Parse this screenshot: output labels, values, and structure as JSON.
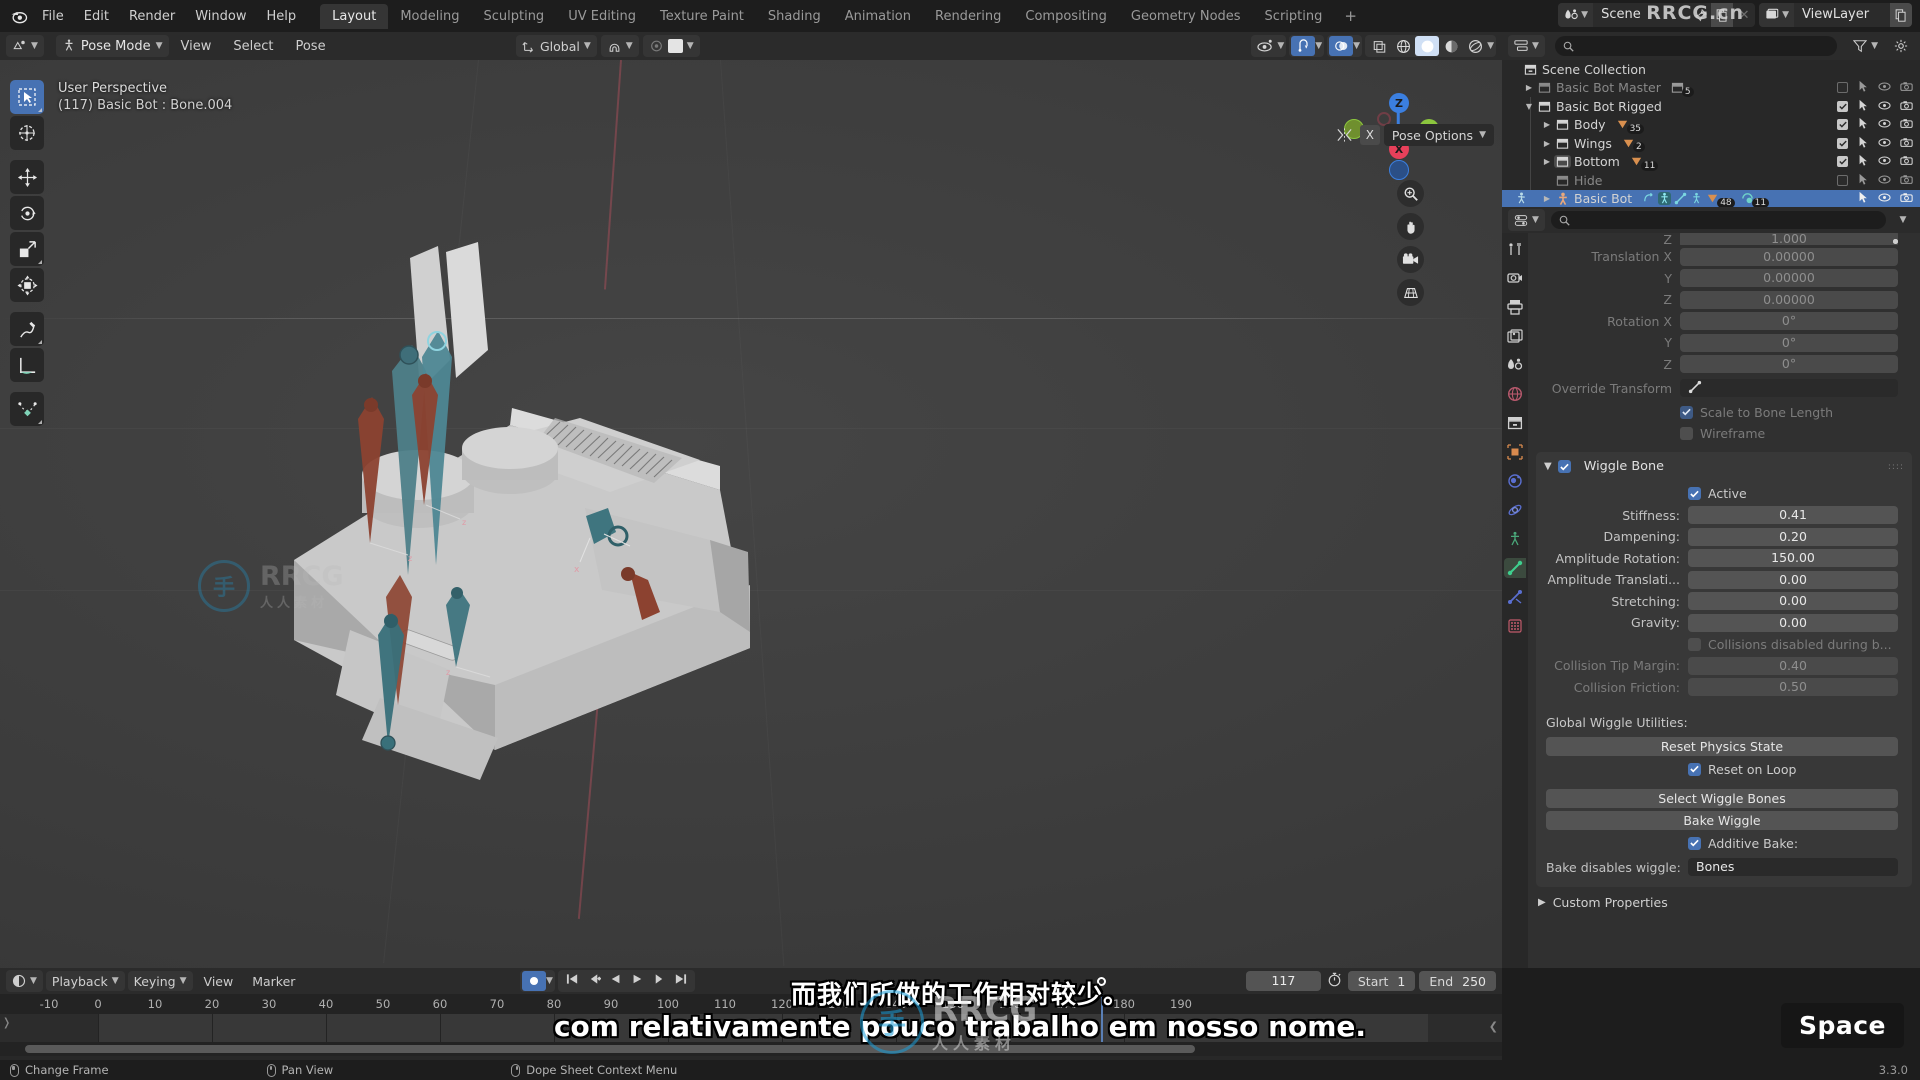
{
  "app": {
    "name": "Blender",
    "version": "3.3.0",
    "logo_icon": "blender-logo"
  },
  "topbar": {
    "menus": [
      "File",
      "Edit",
      "Render",
      "Window",
      "Help"
    ],
    "workspaces": [
      {
        "label": "Layout",
        "active": true
      },
      {
        "label": "Modeling",
        "active": false
      },
      {
        "label": "Sculpting",
        "active": false
      },
      {
        "label": "UV Editing",
        "active": false
      },
      {
        "label": "Texture Paint",
        "active": false
      },
      {
        "label": "Shading",
        "active": false
      },
      {
        "label": "Animation",
        "active": false
      },
      {
        "label": "Rendering",
        "active": false
      },
      {
        "label": "Compositing",
        "active": false
      },
      {
        "label": "Geometry Nodes",
        "active": false
      },
      {
        "label": "Scripting",
        "active": false
      }
    ],
    "add_workspace": "+",
    "scene": {
      "icon": "scene-icon",
      "name": "Scene",
      "pin_icon": "pin-icon",
      "copy_icon": "new-scene-icon",
      "close_icon": "close-icon"
    },
    "viewlayer": {
      "icon": "viewlayer-icon",
      "name": "ViewLayer",
      "copy_icon": "new-viewlayer-icon"
    }
  },
  "viewport_header": {
    "editor_type_icon": "editor-3dview-icon",
    "mode_icon": "pose-mode-icon",
    "mode": "Pose Mode",
    "menus": [
      "View",
      "Select",
      "Pose"
    ],
    "transform_orientation": {
      "icon": "orientation-icon",
      "value": "Global"
    },
    "snap_icon": "magnet-icon",
    "proportional_icon": "proportional-edit-icon",
    "proportional_falloff_icon": "falloff-smooth-icon",
    "visibility_icon": "eye-icon",
    "gizmo_icon": "gizmo-icon",
    "overlays_icon": "overlays-icon",
    "xray_icon": "xray-icon",
    "shading_modes": [
      "wireframe",
      "solid",
      "material-preview",
      "rendered"
    ],
    "shading_active": "solid",
    "pose_options": "Pose Options",
    "mirror_icon": "x-mirror-icon",
    "x_button": "X"
  },
  "viewport": {
    "perspective_label": "User Perspective",
    "selection_label": "(117) Basic Bot : Bone.004",
    "gizmo_axes": [
      {
        "label": "Z",
        "color": "#3b7fe0"
      },
      {
        "label": "Y",
        "color": "#8cc63e"
      },
      {
        "label": "X",
        "color": "#e8405a"
      }
    ],
    "nav_buttons": [
      "zoom-icon",
      "hand-pan-icon",
      "camera-icon",
      "grid-ortho-icon"
    ],
    "tools": [
      {
        "name": "tweak-select-tool",
        "icon": "cursor-select-icon",
        "active": true
      },
      {
        "name": "cursor-tool",
        "icon": "3d-cursor-icon",
        "active": false
      },
      {
        "name": "move-tool",
        "icon": "move-arrows-icon",
        "active": false
      },
      {
        "name": "rotate-tool",
        "icon": "rotate-icon",
        "active": false
      },
      {
        "name": "scale-tool",
        "icon": "scale-icon",
        "active": false
      },
      {
        "name": "transform-tool",
        "icon": "transform-icon",
        "active": false
      },
      {
        "name": "annotate-tool",
        "icon": "pencil-icon",
        "active": false
      },
      {
        "name": "measure-tool",
        "icon": "ruler-icon",
        "active": false
      },
      {
        "name": "breakdowner-tool",
        "icon": "curve-points-icon",
        "active": false
      }
    ]
  },
  "outliner": {
    "display_mode_icon": "outliner-icon",
    "filter_icon": "filter-icon",
    "search_placeholder": "",
    "rows": [
      {
        "label": "Scene Collection",
        "indent": 0,
        "icon": "collection-icon",
        "disclosure": "none",
        "dim": false,
        "selected": false,
        "toggles": {
          "checkbox": null,
          "cursor": false,
          "eye": false,
          "camera": false
        },
        "badges": []
      },
      {
        "label": "Basic Bot Master",
        "indent": 1,
        "icon": "collection-icon",
        "disclosure": "closed",
        "dim": true,
        "selected": false,
        "toggles": {
          "checkbox": false,
          "cursor": true,
          "eye": true,
          "camera": true
        },
        "badges": [
          {
            "icon": "collection-icon",
            "count": "5"
          }
        ]
      },
      {
        "label": "Basic Bot Rigged",
        "indent": 1,
        "icon": "collection-icon",
        "disclosure": "open",
        "dim": false,
        "selected": false,
        "toggles": {
          "checkbox": true,
          "cursor": true,
          "eye": true,
          "camera": true
        },
        "badges": []
      },
      {
        "label": "Body",
        "indent": 2,
        "icon": "collection-icon",
        "disclosure": "closed",
        "dim": false,
        "selected": false,
        "toggles": {
          "checkbox": true,
          "cursor": true,
          "eye": true,
          "camera": true
        },
        "badges": [
          {
            "icon": "mesh-icon",
            "count": "35"
          }
        ]
      },
      {
        "label": "Wings",
        "indent": 2,
        "icon": "collection-icon",
        "disclosure": "closed",
        "dim": false,
        "selected": false,
        "toggles": {
          "checkbox": true,
          "cursor": true,
          "eye": true,
          "camera": true
        },
        "badges": [
          {
            "icon": "mesh-icon",
            "count": "2"
          }
        ]
      },
      {
        "label": "Bottom",
        "indent": 2,
        "icon": "collection-icon",
        "disclosure": "closed",
        "dim": false,
        "selected": false,
        "toggles": {
          "checkbox": true,
          "cursor": true,
          "eye": true,
          "camera": true
        },
        "badges": [
          {
            "icon": "mesh-icon",
            "count": "11"
          }
        ]
      },
      {
        "label": "Hide",
        "indent": 2,
        "icon": "collection-icon",
        "disclosure": "none",
        "dim": true,
        "selected": false,
        "toggles": {
          "checkbox": false,
          "cursor": true,
          "eye": true,
          "camera": true
        },
        "badges": []
      },
      {
        "label": "Basic Bot",
        "indent": 2,
        "icon": "armature-icon",
        "disclosure": "closed",
        "dim": false,
        "selected": true,
        "toggles": {
          "checkbox": null,
          "cursor": true,
          "eye": true,
          "camera": true
        },
        "badges": [
          {
            "icon": "animation-icon",
            "count": ""
          },
          {
            "icon": "pose-icon",
            "count": ""
          },
          {
            "icon": "bone-icon",
            "count": ""
          },
          {
            "icon": "armature-data-icon",
            "count": ""
          },
          {
            "icon": "mesh-icon",
            "count": "48"
          },
          {
            "icon": "modifier-icon",
            "count": "11"
          }
        ]
      }
    ]
  },
  "properties": {
    "editor_icon": "properties-icon",
    "search_placeholder": "",
    "tabs": [
      {
        "name": "tool",
        "icon": "tool-icon",
        "active": false
      },
      {
        "name": "render",
        "icon": "render-camera-icon",
        "active": false
      },
      {
        "name": "output",
        "icon": "printer-icon",
        "active": false
      },
      {
        "name": "view-layer",
        "icon": "images-icon",
        "active": false
      },
      {
        "name": "scene",
        "icon": "scene-cone-icon",
        "active": false
      },
      {
        "name": "world",
        "icon": "world-icon",
        "active": false
      },
      {
        "name": "collection",
        "icon": "collection-icon",
        "active": false
      },
      {
        "name": "object",
        "icon": "object-square-icon",
        "active": false
      },
      {
        "name": "modifiers",
        "icon": "wrench-icon",
        "active": false
      },
      {
        "name": "physics",
        "icon": "physics-orbit-icon",
        "active": false
      },
      {
        "name": "object-constraints",
        "icon": "constraint-icon",
        "active": false
      },
      {
        "name": "bone",
        "icon": "bone-icon",
        "active": true
      },
      {
        "name": "bone-constraints",
        "icon": "bone-constraint-icon",
        "active": false
      },
      {
        "name": "texture",
        "icon": "checker-texture-icon",
        "active": false
      }
    ],
    "transform_fields": [
      {
        "label": "Z",
        "value": "1.000",
        "dim": true,
        "clipped": true
      },
      {
        "label": "Translation X",
        "value": "0.00000",
        "dim": true
      },
      {
        "label": "Y",
        "value": "0.00000",
        "dim": true
      },
      {
        "label": "Z",
        "value": "0.00000",
        "dim": true
      },
      {
        "label": "Rotation X",
        "value": "0°",
        "dim": true
      },
      {
        "label": "Y",
        "value": "0°",
        "dim": true
      },
      {
        "label": "Z",
        "value": "0°",
        "dim": true
      }
    ],
    "override_transform": {
      "label": "Override Transform",
      "icon": "bone-icon",
      "value": ""
    },
    "scale_to_bone_length": {
      "label": "Scale to Bone Length",
      "checked": true,
      "dim": true
    },
    "wireframe": {
      "label": "Wireframe",
      "checked": false,
      "dim": true
    },
    "wiggle_bone": {
      "panel_title": "Wiggle Bone",
      "panel_checked": true,
      "active": {
        "label": "Active",
        "checked": true
      },
      "fields": [
        {
          "label": "Stiffness:",
          "value": "0.41",
          "dim": false
        },
        {
          "label": "Dampening:",
          "value": "0.20",
          "dim": false
        },
        {
          "label": "Amplitude Rotation:",
          "value": "150.00",
          "dim": false
        },
        {
          "label": "Amplitude Translati...",
          "value": "0.00",
          "dim": false
        },
        {
          "label": "Stretching:",
          "value": "0.00",
          "dim": false
        },
        {
          "label": "Gravity:",
          "value": "0.00",
          "dim": false
        }
      ],
      "collisions_disabled": {
        "label": "Collisions disabled during b...",
        "checked": false,
        "dim": true
      },
      "collision_fields": [
        {
          "label": "Collision Tip Margin:",
          "value": "0.40",
          "dim": true
        },
        {
          "label": "Collision Friction:",
          "value": "0.50",
          "dim": true
        }
      ],
      "global_utilities_label": "Global Wiggle Utilities:",
      "reset_physics_state": "Reset Physics State",
      "reset_on_loop": {
        "label": "Reset on Loop",
        "checked": true
      },
      "select_wiggle_bones": "Select Wiggle Bones",
      "bake_wiggle": "Bake Wiggle",
      "additive_bake": {
        "label": "Additive Bake:",
        "checked": true
      },
      "bake_disables_wiggle": {
        "label": "Bake disables wiggle:",
        "value": "Bones"
      }
    },
    "custom_properties": "Custom Properties"
  },
  "timeline": {
    "editor_icon": "timeline-icon",
    "menus_dd": [
      "Playback",
      "Keying"
    ],
    "menus": [
      "View",
      "Marker"
    ],
    "auto_key_icon": "record-icon",
    "nav_icons": [
      "jump-start-icon",
      "prev-keyframe-icon",
      "play-reverse-icon",
      "play-icon",
      "next-keyframe-icon",
      "jump-end-icon"
    ],
    "current_frame": "117",
    "timer_icon": "stopwatch-icon",
    "start_label": "Start",
    "start_value": "1",
    "end_label": "End",
    "end_value": "250",
    "ruler_ticks": [
      "-10",
      "0",
      "10",
      "20",
      "30",
      "40",
      "50",
      "60",
      "70",
      "80",
      "90",
      "100",
      "110",
      "120",
      "130",
      "140",
      "150",
      "160",
      "170",
      "180",
      "190"
    ]
  },
  "statusbar": {
    "items": [
      {
        "mouse": "left",
        "label": "Change Frame"
      },
      {
        "mouse": "middle",
        "label": "Pan View"
      },
      {
        "mouse": "right",
        "label": "Dope Sheet Context Menu"
      }
    ],
    "version": "3.3.0"
  },
  "overlays": {
    "subtitle_cn": "而我们所做的工作相对较少。",
    "subtitle_pt": "com relativamente pouco trabalho em nosso nome.",
    "key_hint": "Space",
    "watermark_text": "RRCG",
    "watermark_sub": "人人素材",
    "watermark_topright": "RRCG.cn"
  }
}
